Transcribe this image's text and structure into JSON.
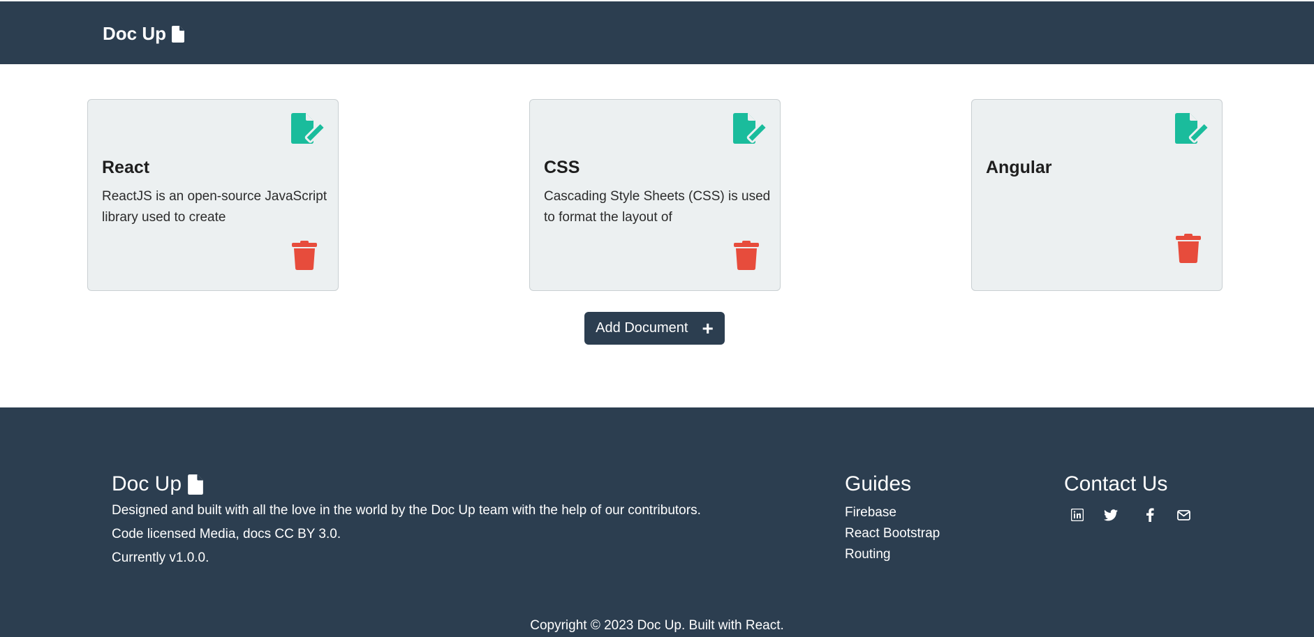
{
  "navbar": {
    "brand": "Doc Up",
    "brand_icon": "file-icon"
  },
  "documents": [
    {
      "title": "React",
      "description": "ReactJS is an open-source JavaScript library used to create"
    },
    {
      "title": "CSS",
      "description": "Cascading Style Sheets (CSS) is used to format the layout of"
    },
    {
      "title": "Angular",
      "description": ""
    }
  ],
  "icons": {
    "edit": "file-pen-icon",
    "delete": "trash-icon"
  },
  "add_button": {
    "label": "Add Document",
    "icon": "+"
  },
  "footer": {
    "brand": "Doc Up",
    "lines": [
      "Designed and built with all the love in the world by the Doc Up team with the help of our contributors.",
      "Code licensed Media, docs CC BY 3.0.",
      "Currently v1.0.0."
    ],
    "guides_heading": "Guides",
    "guides": [
      "Firebase",
      "React Bootstrap",
      "Routing"
    ],
    "contact_heading": "Contact Us",
    "social": [
      "linkedin-icon",
      "twitter-icon",
      "facebook-icon",
      "envelope-icon"
    ],
    "copyright": "Copyright © 2023 Doc Up. Built with React."
  },
  "colors": {
    "navbar": "#2c3e50",
    "card_bg": "#ecf0f1",
    "edit": "#1abc9c",
    "delete": "#e74c3c",
    "white": "#ffffff"
  }
}
